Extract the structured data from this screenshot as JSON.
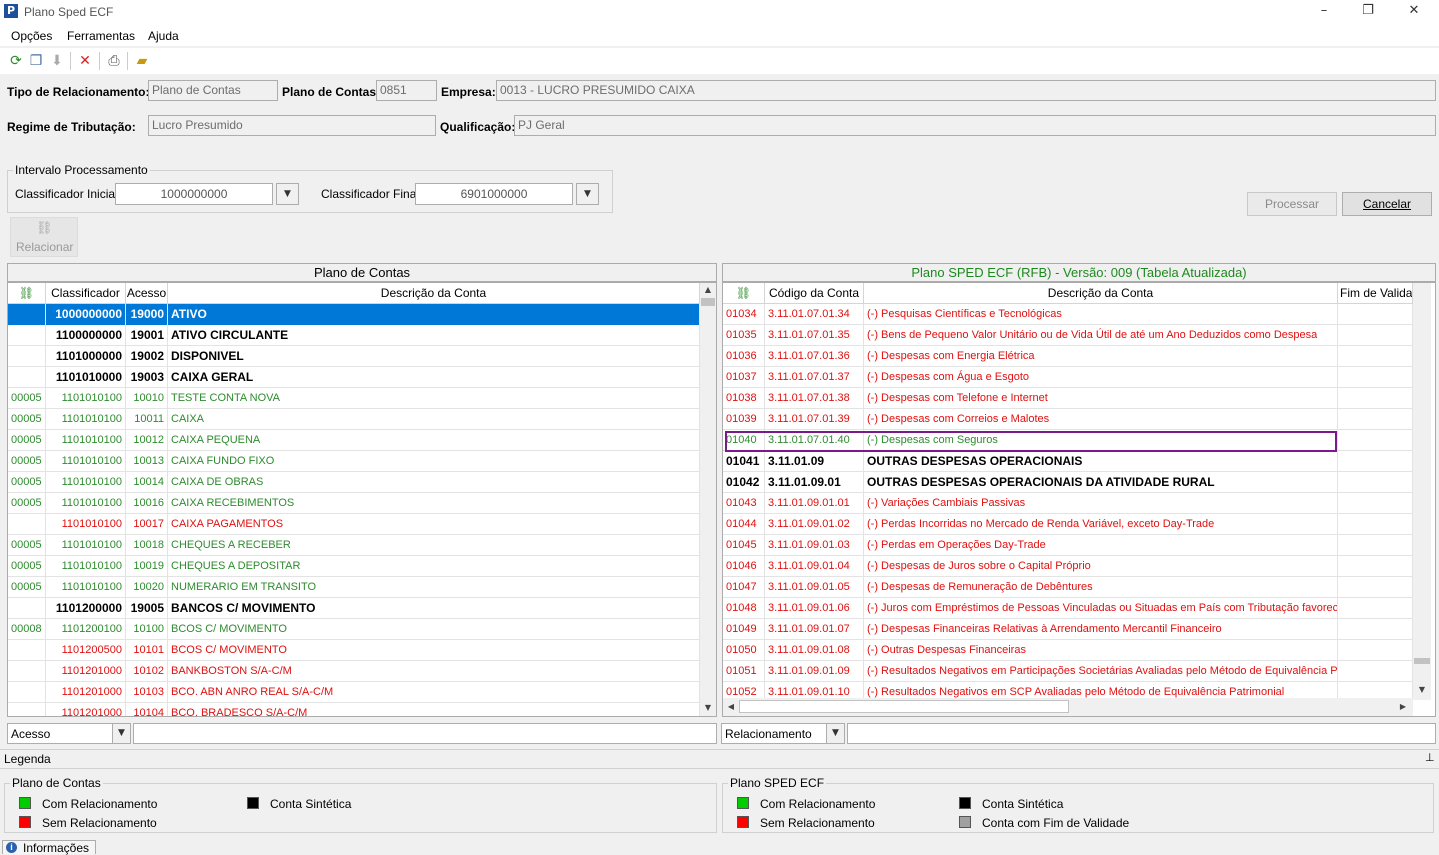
{
  "window": {
    "title": "Plano Sped ECF"
  },
  "menu": [
    "Opções",
    "Ferramentas",
    "Ajuda"
  ],
  "header": {
    "tipo_label": "Tipo de Relacionamento:",
    "tipo_value": "Plano de Contas",
    "plano_label": "Plano de Contas:",
    "plano_value": "0851",
    "empresa_label": "Empresa:",
    "empresa_value": "0013 - LUCRO PRESUMIDO CAIXA",
    "regime_label": "Regime de Tributação:",
    "regime_value": "Lucro Presumido",
    "qualif_label": "Qualificação:",
    "qualif_value": "PJ Geral"
  },
  "intervalo": {
    "title": "Intervalo Processamento",
    "inicial_label": "Classificador Inicial:",
    "inicial_value": "1000000000",
    "final_label": "Classificador Final:",
    "final_value": "6901000000",
    "processar": "Processar",
    "cancelar": "Cancelar",
    "relacionar": "Relacionar"
  },
  "left_grid": {
    "title": "Plano de Contas",
    "headers": [
      "Classificador",
      "Acesso",
      "Descrição da Conta"
    ],
    "rows": [
      {
        "rel": "",
        "clas": "1000000000",
        "acc": "19000",
        "desc": "ATIVO",
        "style": "sel"
      },
      {
        "rel": "",
        "clas": "1100000000",
        "acc": "19001",
        "desc": "ATIVO CIRCULANTE",
        "style": "bold"
      },
      {
        "rel": "",
        "clas": "1101000000",
        "acc": "19002",
        "desc": "DISPONIVEL",
        "style": "bold"
      },
      {
        "rel": "",
        "clas": "1101010000",
        "acc": "19003",
        "desc": "CAIXA GERAL",
        "style": "bold"
      },
      {
        "rel": "00005",
        "clas": "1101010100",
        "acc": "10010",
        "desc": "TESTE CONTA NOVA",
        "style": "green"
      },
      {
        "rel": "00005",
        "clas": "1101010100",
        "acc": "10011",
        "desc": "CAIXA",
        "style": "green"
      },
      {
        "rel": "00005",
        "clas": "1101010100",
        "acc": "10012",
        "desc": "CAIXA PEQUENA",
        "style": "green"
      },
      {
        "rel": "00005",
        "clas": "1101010100",
        "acc": "10013",
        "desc": "CAIXA FUNDO FIXO",
        "style": "green"
      },
      {
        "rel": "00005",
        "clas": "1101010100",
        "acc": "10014",
        "desc": "CAIXA DE OBRAS",
        "style": "green"
      },
      {
        "rel": "00005",
        "clas": "1101010100",
        "acc": "10016",
        "desc": "CAIXA RECEBIMENTOS",
        "style": "green"
      },
      {
        "rel": "",
        "clas": "1101010100",
        "acc": "10017",
        "desc": "CAIXA PAGAMENTOS",
        "style": "red"
      },
      {
        "rel": "00005",
        "clas": "1101010100",
        "acc": "10018",
        "desc": "CHEQUES A RECEBER",
        "style": "green"
      },
      {
        "rel": "00005",
        "clas": "1101010100",
        "acc": "10019",
        "desc": "CHEQUES A DEPOSITAR",
        "style": "green"
      },
      {
        "rel": "00005",
        "clas": "1101010100",
        "acc": "10020",
        "desc": "NUMERARIO EM TRANSITO",
        "style": "green"
      },
      {
        "rel": "",
        "clas": "1101200000",
        "acc": "19005",
        "desc": "BANCOS C/ MOVIMENTO",
        "style": "bold"
      },
      {
        "rel": "00008",
        "clas": "1101200100",
        "acc": "10100",
        "desc": "BCOS C/ MOVIMENTO",
        "style": "green"
      },
      {
        "rel": "",
        "clas": "1101200500",
        "acc": "10101",
        "desc": "BCOS C/ MOVIMENTO",
        "style": "red"
      },
      {
        "rel": "",
        "clas": "1101201000",
        "acc": "10102",
        "desc": "BANKBOSTON S/A-C/M",
        "style": "red"
      },
      {
        "rel": "",
        "clas": "1101201000",
        "acc": "10103",
        "desc": "BCO. ABN ANRO REAL S/A-C/M",
        "style": "red"
      },
      {
        "rel": "",
        "clas": "1101201000",
        "acc": "10104",
        "desc": "BCO. BRADESCO S/A-C/M",
        "style": "red"
      }
    ]
  },
  "right_grid": {
    "title": "Plano SPED ECF (RFB) - Versão: 009 (Tabela Atualizada)",
    "headers": [
      "Código da Conta",
      "Descrição da Conta",
      "Fim de Validade"
    ],
    "rows": [
      {
        "id": "01034",
        "cod": "3.11.01.07.01.34",
        "desc": "(-) Pesquisas Científicas e Tecnológicas",
        "style": "red"
      },
      {
        "id": "01035",
        "cod": "3.11.01.07.01.35",
        "desc": "(-) Bens de Pequeno Valor Unitário ou de Vida Útil de até um Ano Deduzidos como Despesa",
        "style": "red"
      },
      {
        "id": "01036",
        "cod": "3.11.01.07.01.36",
        "desc": "(-) Despesas com Energia Elétrica",
        "style": "red"
      },
      {
        "id": "01037",
        "cod": "3.11.01.07.01.37",
        "desc": "(-) Despesas com Água e Esgoto",
        "style": "red"
      },
      {
        "id": "01038",
        "cod": "3.11.01.07.01.38",
        "desc": "(-) Despesas com Telefone e Internet",
        "style": "red"
      },
      {
        "id": "01039",
        "cod": "3.11.01.07.01.39",
        "desc": "(-) Despesas com Correios e Malotes",
        "style": "red"
      },
      {
        "id": "01040",
        "cod": "3.11.01.07.01.40",
        "desc": "(-) Despesas com Seguros",
        "style": "green"
      },
      {
        "id": "01041",
        "cod": "3.11.01.09",
        "desc": "OUTRAS DESPESAS OPERACIONAIS",
        "style": "bold"
      },
      {
        "id": "01042",
        "cod": "3.11.01.09.01",
        "desc": "OUTRAS DESPESAS OPERACIONAIS DA ATIVIDADE RURAL",
        "style": "bold"
      },
      {
        "id": "01043",
        "cod": "3.11.01.09.01.01",
        "desc": "(-) Variações Cambiais Passivas",
        "style": "red"
      },
      {
        "id": "01044",
        "cod": "3.11.01.09.01.02",
        "desc": "(-) Perdas Incorridas no Mercado de Renda Variável, exceto Day-Trade",
        "style": "red"
      },
      {
        "id": "01045",
        "cod": "3.11.01.09.01.03",
        "desc": "(-) Perdas em Operações Day-Trade",
        "style": "red"
      },
      {
        "id": "01046",
        "cod": "3.11.01.09.01.04",
        "desc": "(-) Despesas de Juros sobre o Capital Próprio",
        "style": "red"
      },
      {
        "id": "01047",
        "cod": "3.11.01.09.01.05",
        "desc": "(-) Despesas de Remuneração de Debêntures",
        "style": "red"
      },
      {
        "id": "01048",
        "cod": "3.11.01.09.01.06",
        "desc": "(-) Juros com Empréstimos de Pessoas Vinculadas ou Situadas em País com Tributação favorecida",
        "style": "red"
      },
      {
        "id": "01049",
        "cod": "3.11.01.09.01.07",
        "desc": "(-) Despesas Financeiras Relativas à Arrendamento Mercantil Financeiro",
        "style": "red"
      },
      {
        "id": "01050",
        "cod": "3.11.01.09.01.08",
        "desc": "(-) Outras Despesas Financeiras",
        "style": "red"
      },
      {
        "id": "01051",
        "cod": "3.11.01.09.01.09",
        "desc": "(-) Resultados Negativos em Participações Societárias Avaliadas pelo Método de Equivalência Patri",
        "style": "red"
      },
      {
        "id": "01052",
        "cod": "3.11.01.09.01.10",
        "desc": "(-) Resultados Negativos em SCP Avaliadas pelo Método de Equivalência Patrimonial",
        "style": "red"
      }
    ]
  },
  "filters": {
    "left_combo": "Acesso",
    "right_combo": "Relacionamento"
  },
  "legend": {
    "title": "Legenda",
    "left_title": "Plano de Contas",
    "right_title": "Plano SPED ECF",
    "com_rel": "Com Relacionamento",
    "sem_rel": "Sem Relacionamento",
    "sintetica": "Conta Sintética",
    "fim_validade": "Conta com Fim de Validade",
    "colors": {
      "green": "#00cc00",
      "red": "#ff0000",
      "black": "#000000",
      "gray": "#a0a0a0"
    }
  },
  "bottom_tab": "Informações"
}
